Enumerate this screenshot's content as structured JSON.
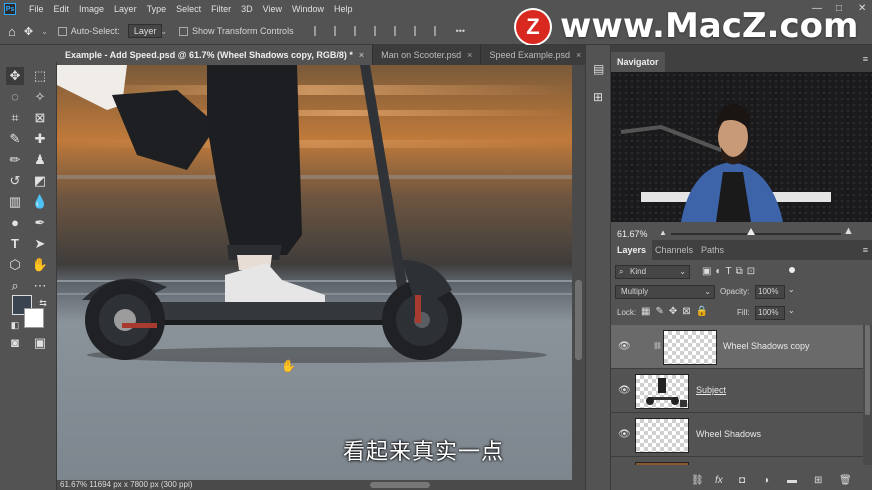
{
  "menu": [
    "File",
    "Edit",
    "Image",
    "Layer",
    "Type",
    "Select",
    "Filter",
    "3D",
    "View",
    "Window",
    "Help"
  ],
  "window_controls": {
    "minimize": "—",
    "maximize": "□",
    "close": "✕"
  },
  "options_bar": {
    "auto_select_label": "Auto-Select:",
    "auto_select_value": "Layer",
    "show_transform_label": "Show Transform Controls",
    "more": "•••"
  },
  "tabs": [
    {
      "label": "Example - Add Speed.psd @ 61.7% (Wheel Shadows copy, RGB/8) *",
      "close": "×"
    },
    {
      "label": "Man on Scooter.psd",
      "close": "×"
    },
    {
      "label": "Speed Example.psd",
      "close": "×"
    }
  ],
  "tabs_overflow": "»",
  "watermark": {
    "logo": "Z",
    "text": "www.MacZ.com"
  },
  "subtitle": "看起来真实一点",
  "status": "61.67%  11694 px x 7800 px (300 ppi)",
  "navigator": {
    "title": "Navigator",
    "zoom": "61.67%",
    "zoom_slider_fraction": 0.47
  },
  "layers_panel": {
    "tabs": [
      "Layers",
      "Channels",
      "Paths"
    ],
    "filter_kind": "Kind",
    "blend_mode": "Multiply",
    "opacity_label": "Opacity:",
    "opacity_value": "100%",
    "lock_label": "Lock:",
    "fill_label": "Fill:",
    "fill_value": "100%",
    "layers": [
      {
        "name": "Wheel Shadows copy",
        "selected": true
      },
      {
        "name": "Subject",
        "selected": false
      },
      {
        "name": "Wheel Shadows",
        "selected": false
      }
    ],
    "footer_icons": [
      "link-icon",
      "fx-icon",
      "mask-icon",
      "adjustment-icon",
      "folder-icon",
      "new-layer-icon",
      "trash-icon"
    ]
  },
  "colors": {
    "accent": "#31a8ff",
    "panel_bg": "#535353",
    "brand_red": "#d9281f"
  }
}
